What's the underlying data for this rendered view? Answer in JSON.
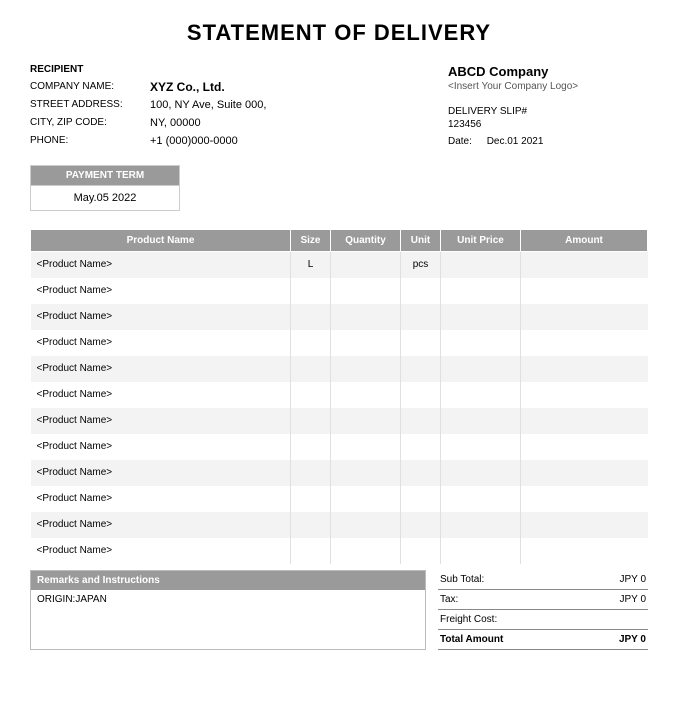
{
  "title": "STATEMENT OF DELIVERY",
  "recipient": {
    "section_label": "RECIPIENT",
    "company_label": "COMPANY NAME:",
    "company_value": "XYZ Co., Ltd.",
    "street_label": "STREET ADDRESS:",
    "street_value": "100, NY Ave, Suite 000,",
    "city_label": "CITY, ZIP CODE:",
    "city_value": "NY, 00000",
    "phone_label": "PHONE:",
    "phone_value": "+1 (000)000-0000"
  },
  "company": {
    "name": "ABCD Company",
    "logo_placeholder": "<Insert Your Company Logo>",
    "slip_label": "DELIVERY SLIP#",
    "slip_number": "123456",
    "date_label": "Date:",
    "date_value": "Dec.01 2021"
  },
  "payment_term": {
    "header": "PAYMENT TERM",
    "value": "May.05 2022"
  },
  "columns": {
    "product_name": "Product Name",
    "size": "Size",
    "quantity": "Quantity",
    "unit": "Unit",
    "unit_price": "Unit Price",
    "amount": "Amount"
  },
  "rows": [
    {
      "name": "<Product Name>",
      "size": "L",
      "qty": "",
      "unit": "pcs",
      "uprice": "",
      "amount": ""
    },
    {
      "name": "<Product Name>",
      "size": "",
      "qty": "",
      "unit": "",
      "uprice": "",
      "amount": ""
    },
    {
      "name": "<Product Name>",
      "size": "",
      "qty": "",
      "unit": "",
      "uprice": "",
      "amount": ""
    },
    {
      "name": "<Product Name>",
      "size": "",
      "qty": "",
      "unit": "",
      "uprice": "",
      "amount": ""
    },
    {
      "name": "<Product Name>",
      "size": "",
      "qty": "",
      "unit": "",
      "uprice": "",
      "amount": ""
    },
    {
      "name": "<Product Name>",
      "size": "",
      "qty": "",
      "unit": "",
      "uprice": "",
      "amount": ""
    },
    {
      "name": "<Product Name>",
      "size": "",
      "qty": "",
      "unit": "",
      "uprice": "",
      "amount": ""
    },
    {
      "name": "<Product Name>",
      "size": "",
      "qty": "",
      "unit": "",
      "uprice": "",
      "amount": ""
    },
    {
      "name": "<Product Name>",
      "size": "",
      "qty": "",
      "unit": "",
      "uprice": "",
      "amount": ""
    },
    {
      "name": "<Product Name>",
      "size": "",
      "qty": "",
      "unit": "",
      "uprice": "",
      "amount": ""
    },
    {
      "name": "<Product Name>",
      "size": "",
      "qty": "",
      "unit": "",
      "uprice": "",
      "amount": ""
    },
    {
      "name": "<Product Name>",
      "size": "",
      "qty": "",
      "unit": "",
      "uprice": "",
      "amount": ""
    }
  ],
  "remarks": {
    "header": "Remarks and Instructions",
    "body": "ORIGIN:JAPAN"
  },
  "totals": {
    "subtotal_label": "Sub Total:",
    "subtotal_value": "JPY 0",
    "tax_label": "Tax:",
    "tax_value": "JPY 0",
    "freight_label": "Freight Cost:",
    "freight_value": "",
    "total_label": "Total Amount",
    "total_value": "JPY 0"
  }
}
